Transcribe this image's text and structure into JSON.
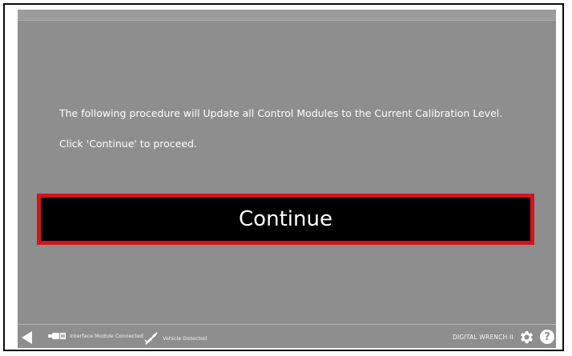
{
  "message": {
    "line1": "The following procedure will Update all Control Modules to the Current Calibration Level.",
    "line2": "Click 'Continue' to proceed."
  },
  "continue_button": {
    "label": "Continue",
    "border_color": "#d4141c",
    "background": "#000000"
  },
  "footer": {
    "back_icon": "back-arrow-icon",
    "interface_status": {
      "icon": "interface-module-icon",
      "label": "Interface Module Connected"
    },
    "vehicle_status": {
      "icon": "vehicle-disconnected-icon",
      "label": "Vehicle Detected"
    },
    "brand": "DIGITAL WRENCH II",
    "settings_icon": "gear-icon",
    "help_label": "?"
  },
  "colors": {
    "screen_background": "#8e8e8e",
    "text": "#ffffff"
  }
}
